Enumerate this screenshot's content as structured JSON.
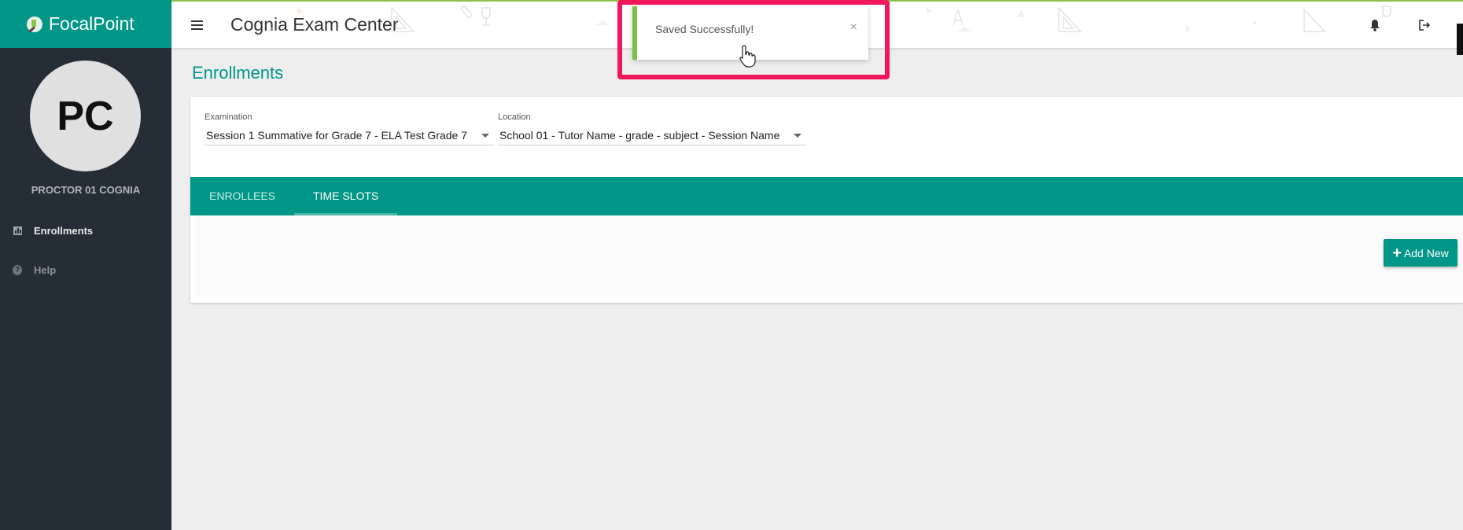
{
  "sidebar": {
    "logo_text": "FocalPoint",
    "avatar_initials": "PC",
    "user_name": "PROCTOR 01 COGNIA",
    "items": [
      {
        "label": "Enrollments",
        "icon": "bar-chart-icon",
        "active": true
      },
      {
        "label": "Help",
        "icon": "help-icon",
        "active": false
      }
    ]
  },
  "header": {
    "title": "Cognia Exam Center",
    "icons": [
      "menu-icon",
      "bell-icon",
      "logout-icon"
    ]
  },
  "page": {
    "title": "Enrollments"
  },
  "filters": {
    "examination_label": "Examination",
    "examination_value": "Session 1 Summative for Grade 7 - ELA Test Grade 7",
    "location_label": "Location",
    "location_value": "School 01 - Tutor Name - grade - subject - Session Name"
  },
  "tabs": [
    {
      "label": "ENROLLEES",
      "active": false
    },
    {
      "label": "TIME SLOTS",
      "active": true
    }
  ],
  "actions": {
    "add_new_label": "Add New"
  },
  "toast": {
    "message": "Saved Successfully!",
    "close": "×"
  },
  "colors": {
    "primary": "#009688",
    "sidebar": "#252d36",
    "success": "#7ac143",
    "highlight": "#f0185a"
  }
}
